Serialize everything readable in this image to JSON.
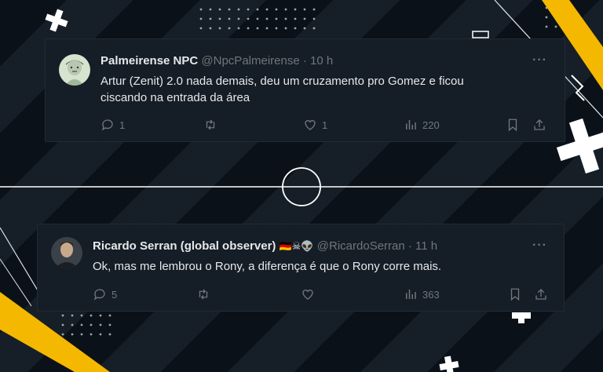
{
  "tweets": [
    {
      "name": "Palmeirense NPC",
      "handle": "@NpcPalmeirense",
      "time": "· 10 h",
      "text_line1": "Artur (Zenit) 2.0 nada demais, deu um cruzamento pro Gomez  e ficou",
      "text_line2": "ciscando na entrada da área",
      "replies": "1",
      "likes": "1",
      "views": "220",
      "more": "···"
    },
    {
      "name": "Ricardo Serran (global observer)",
      "badges": "🇩🇪☠👽",
      "handle": "@RicardoSerran",
      "time": "· 11 h",
      "text_line1": "Ok, mas me lembrou o Rony, a diferença é que o Rony corre mais.",
      "replies": "5",
      "views": "363",
      "more": "···"
    }
  ],
  "colors": {
    "accent_yellow": "#f5b800",
    "card_bg": "#151d26",
    "muted": "#71767b",
    "text": "#e7e9ea"
  }
}
